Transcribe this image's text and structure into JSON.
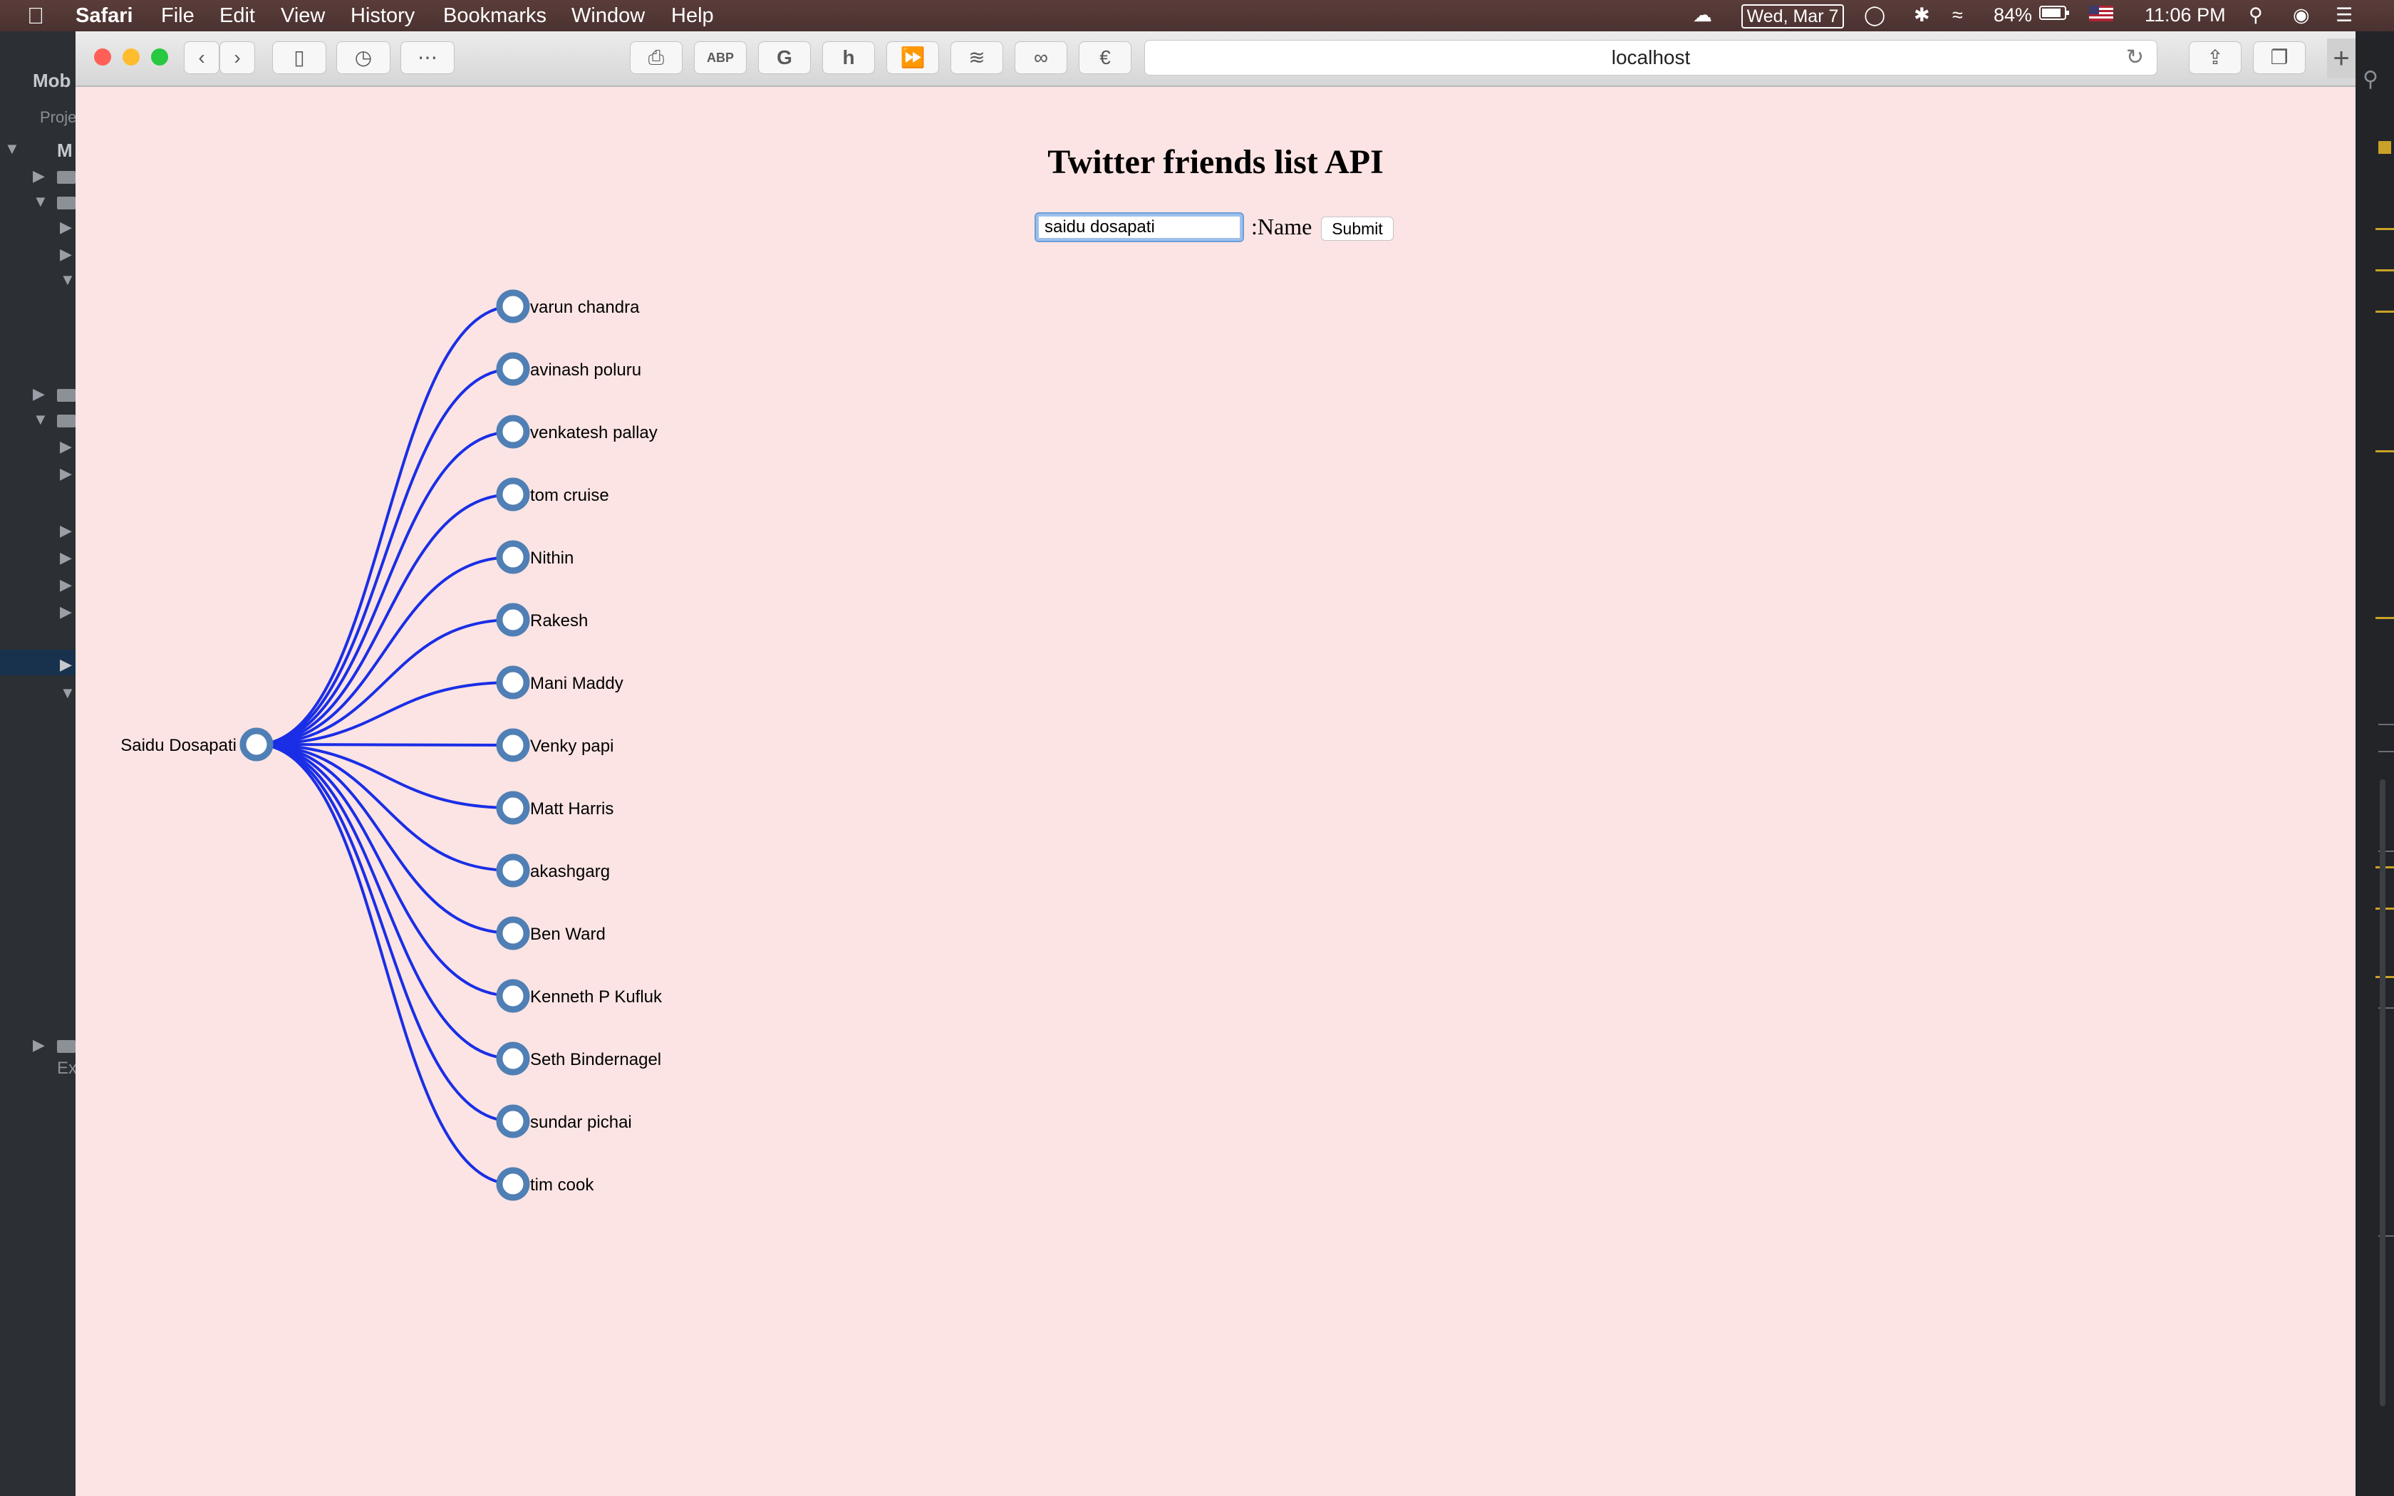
{
  "menubar": {
    "app_name": "Safari",
    "menus": [
      "File",
      "Edit",
      "View",
      "History",
      "Bookmarks",
      "Window",
      "Help"
    ],
    "date": "Wed, Mar 7",
    "battery": "84%",
    "time": "11:06 PM",
    "icons": [
      "apple-icon",
      "creative-cloud-icon",
      "message-icon",
      "bluetooth-icon",
      "wifi-icon",
      "battery-icon",
      "flag-icon",
      "spotlight-icon",
      "siri-icon",
      "notification-center-icon"
    ]
  },
  "ide": {
    "title_fragment": "Mob",
    "project_fragment": "Proje",
    "root_fragment": "M",
    "bottom_fragment": "Ex"
  },
  "browser": {
    "url": "localhost",
    "toolbar_icons": [
      "back-icon",
      "forward-icon",
      "sidebar-icon",
      "history-icon",
      "grid-icon",
      "print-icon",
      "adblock-icon",
      "grammarly-icon",
      "honey-icon",
      "fast-forward-icon",
      "layers-icon",
      "mask-icon",
      "evernote-icon",
      "reload-icon",
      "share-icon",
      "tabs-icon",
      "new-tab-icon"
    ],
    "glyphs": {
      "back": "‹",
      "forward": "›",
      "sidebar": "▯",
      "history": "◷",
      "grid": "⋯",
      "print": "⎙",
      "adblock": "ABP",
      "grammarly": "G",
      "honey": "h",
      "fast_forward": "⏩",
      "layers": "≋",
      "mask": "∞",
      "evernote": "€",
      "reload": "↻",
      "share": "⇪",
      "tabs": "❐",
      "plus": "+"
    }
  },
  "page": {
    "title": "Twitter friends list API",
    "input_value": "saidu dosapati",
    "name_label": ":Name",
    "submit_label": "Submit"
  },
  "tree": {
    "root": "Saidu Dosapati",
    "children": [
      "varun chandra",
      "avinash poluru",
      "venkatesh pallay",
      "tom cruise",
      "Nithin",
      "Rakesh",
      "Mani Maddy",
      "Venky papi",
      "Matt Harris",
      "akashgarg",
      "Ben Ward",
      "Kenneth P Kufluk",
      "Seth Bindernagel",
      "sundar pichai",
      "tim cook"
    ],
    "link_color": "#1a2ee6",
    "node_stroke": "#4f7fb5",
    "node_fill": "#ffffff"
  }
}
